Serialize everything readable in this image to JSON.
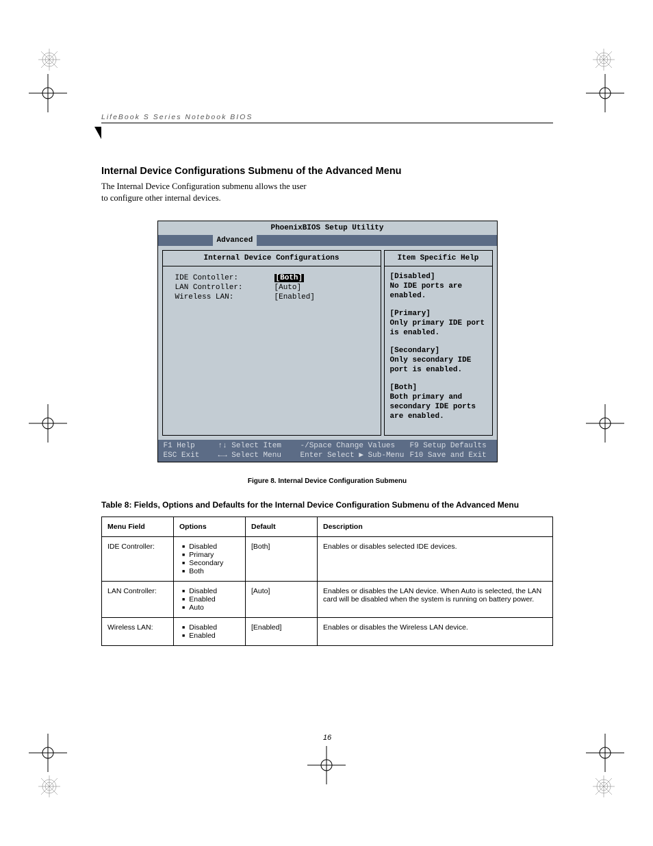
{
  "runningHead": "LifeBook S Series Notebook BIOS",
  "heading": "Internal Device Configurations Submenu of the Advanced Menu",
  "intro": "The Internal Device Configuration submenu allows the user to configure other internal devices.",
  "bios": {
    "title": "PhoenixBIOS Setup Utility",
    "activeTab": "Advanced",
    "leftTitle": "Internal Device Configurations",
    "rows": [
      {
        "label": "IDE Contoller:",
        "value": "[Both]",
        "selected": true
      },
      {
        "label": "LAN Controller:",
        "value": "[Auto]",
        "selected": false
      },
      {
        "label": "Wireless LAN:",
        "value": "[Enabled]",
        "selected": false
      }
    ],
    "helpTitle": "Item Specific Help",
    "help": [
      "[Disabled]\nNo IDE ports are enabled.",
      "[Primary]\nOnly primary IDE port is enabled.",
      "[Secondary]\nOnly secondary IDE port is enabled.",
      "[Both]\nBoth primary and secondary IDE ports are enabled."
    ],
    "footer": {
      "r1": {
        "c1": "F1  Help",
        "c2": "↑↓ Select Item",
        "c3": "-/Space  Change Values",
        "c4": "F9   Setup Defaults"
      },
      "r2": {
        "c1": "ESC Exit",
        "c2": "←→ Select Menu",
        "c3": "Enter  Select ▶ Sub-Menu",
        "c4": "F10  Save and Exit"
      }
    }
  },
  "figureCaption": "Figure 8.   Internal Device Configuration Submenu",
  "tableTitle": "Table 8: Fields, Options and Defaults for the Internal Device Configuration Submenu of the Advanced Menu",
  "table": {
    "headers": [
      "Menu Field",
      "Options",
      "Default",
      "Description"
    ],
    "rows": [
      {
        "field": "IDE Controller:",
        "options": [
          "Disabled",
          "Primary",
          "Secondary",
          "Both"
        ],
        "default": "[Both]",
        "desc": "Enables or disables selected IDE devices."
      },
      {
        "field": "LAN Controller:",
        "options": [
          "Disabled",
          "Enabled",
          "Auto"
        ],
        "default": "[Auto]",
        "desc": "Enables or disables the LAN device. When Auto is selected, the LAN card will be disabled when the system is running on battery power."
      },
      {
        "field": "Wireless LAN:",
        "options": [
          "Disabled",
          "Enabled"
        ],
        "default": "[Enabled]",
        "desc": "Enables or disables the Wireless LAN device."
      }
    ]
  },
  "pageNumber": "16"
}
